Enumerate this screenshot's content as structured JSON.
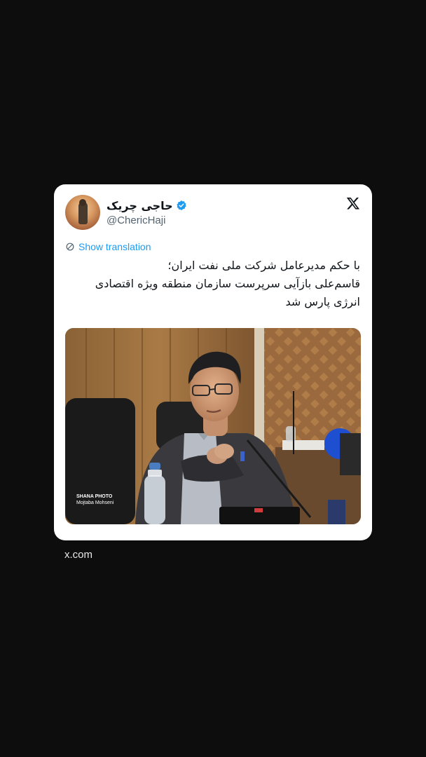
{
  "tweet": {
    "display_name": "حاجی چریک",
    "handle": "@ChericHaji",
    "show_translation_label": "Show translation",
    "text_lines": [
      "با حکم مدیرعامل شرکت ملی نفت ایران؛",
      "قاسم‌علی بازآیی سرپرست سازمان منطقه ویژه اقتصادی",
      "انرژی پارس شد"
    ],
    "media": {
      "watermark_title": "SHANA PHOTO",
      "watermark_credit": "Mojtaba Mohseni"
    }
  },
  "footer": {
    "domain": "x.com"
  },
  "colors": {
    "background": "#0d0d0d",
    "card": "#ffffff",
    "link_blue": "#1d9bf0",
    "verified_blue": "#1d9bf0"
  },
  "icons": {
    "brand": "x-logo-icon",
    "verified": "verified-badge-icon",
    "translate": "translate-icon"
  }
}
